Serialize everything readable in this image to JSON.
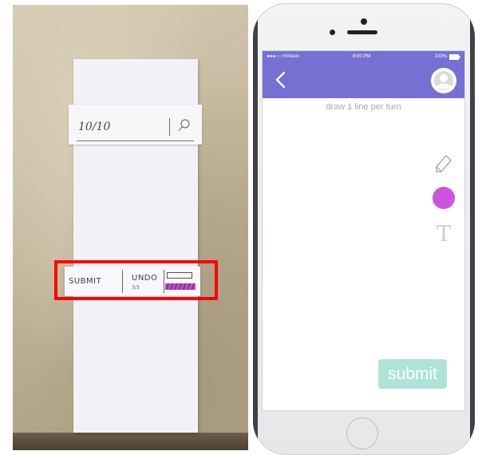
{
  "paper_prototype": {
    "score": "10/10",
    "submit_label": "SUBMIT",
    "undo_label": "UNDO",
    "undo_count": "3/3"
  },
  "phone": {
    "status": {
      "carrier": "●●●○○ InVision",
      "time": "8:00 PM",
      "battery": "100%"
    },
    "hint": "draw 1 line per turn",
    "submit_label": "submit",
    "text_tool_glyph": "T",
    "colors": {
      "header": "#7570d2",
      "selected_color": "#cc55e0",
      "submit_bg": "#aee4d8"
    },
    "icons": [
      "back-chevron-icon",
      "avatar-icon",
      "pencil-icon",
      "color-swatch",
      "text-icon"
    ]
  }
}
